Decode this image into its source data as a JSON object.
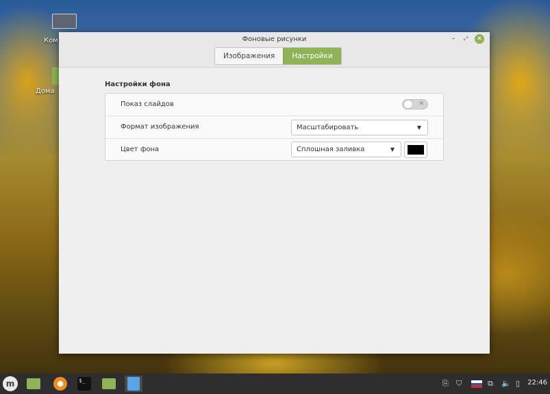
{
  "desktop": {
    "icon1_label": "Ком",
    "icon2_label": "Дома"
  },
  "window": {
    "title": "Фоновые рисунки",
    "tabs": [
      {
        "label": "Изображения",
        "active": false
      },
      {
        "label": "Настройки",
        "active": true
      }
    ],
    "controls": {
      "minimize": "–",
      "maximize": "⤢",
      "close": "✕"
    }
  },
  "settings": {
    "section_title": "Настройки фона",
    "slideshow": {
      "label": "Показ слайдов",
      "enabled": false
    },
    "image_format": {
      "label": "Формат изображения",
      "value": "Масштабировать"
    },
    "bg_color": {
      "label": "Цвет фона",
      "fill_value": "Сплошная заливка",
      "color": "#000000"
    }
  },
  "taskbar": {
    "clock": "22:46",
    "terminal_glyph": "$_",
    "menu_glyph": "m"
  },
  "colors": {
    "accent": "#8fb356",
    "taskbar": "#2e2e2e"
  }
}
